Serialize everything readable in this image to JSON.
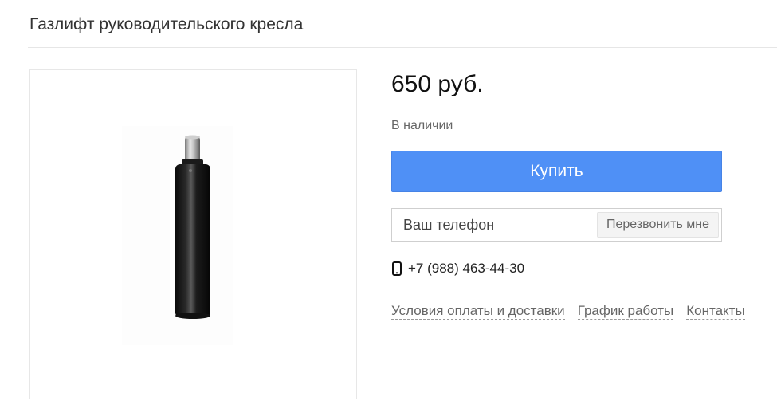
{
  "product": {
    "title": "Газлифт руководительского кресла",
    "price": "650 руб.",
    "availability": "В наличии",
    "image_icon": "gas-lift-cylinder-photo"
  },
  "actions": {
    "buy_label": "Купить",
    "buy_color": "#4f90f6"
  },
  "callback": {
    "phone_placeholder": "Ваш телефон",
    "button_label": "Перезвонить мне"
  },
  "contact": {
    "phone_icon": "mobile-phone-icon",
    "phone": "+7 (988) 463-44-30"
  },
  "links": [
    {
      "label": "Условия оплаты и доставки"
    },
    {
      "label": "График работы"
    },
    {
      "label": "Контакты"
    }
  ]
}
